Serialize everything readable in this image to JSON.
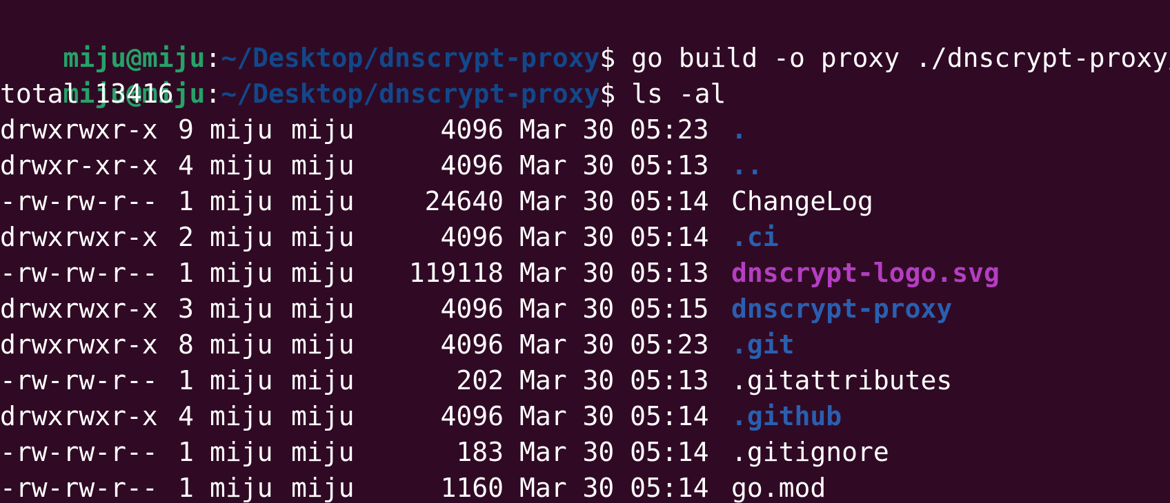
{
  "colors": {
    "background": "#300a24",
    "foreground": "#ffffff",
    "prompt_user": "#26a269",
    "prompt_path": "#12488b",
    "directory": "#2a5fb0",
    "image_file": "#b43ec2"
  },
  "prompts": [
    {
      "user_host": "miju@miju",
      "sep": ":",
      "path": "~/Desktop/dnscrypt-proxy",
      "symbol": "$",
      "command": " go build -o proxy ./dnscrypt-proxy/"
    },
    {
      "user_host": "miju@miju",
      "sep": ":",
      "path": "~/Desktop/dnscrypt-proxy",
      "symbol": "$",
      "command": " ls -al"
    }
  ],
  "total_line": "total 13416",
  "listing": [
    {
      "perm": "drwxrwxr-x",
      "links": "9",
      "owner": "miju",
      "group": "miju",
      "size": "4096",
      "date": "Mar 30 05:23",
      "name": ".",
      "kind": "dir"
    },
    {
      "perm": "drwxr-xr-x",
      "links": "4",
      "owner": "miju",
      "group": "miju",
      "size": "4096",
      "date": "Mar 30 05:13",
      "name": "..",
      "kind": "dir"
    },
    {
      "perm": "-rw-rw-r--",
      "links": "1",
      "owner": "miju",
      "group": "miju",
      "size": "24640",
      "date": "Mar 30 05:14",
      "name": "ChangeLog",
      "kind": "file"
    },
    {
      "perm": "drwxrwxr-x",
      "links": "2",
      "owner": "miju",
      "group": "miju",
      "size": "4096",
      "date": "Mar 30 05:14",
      "name": ".ci",
      "kind": "dir"
    },
    {
      "perm": "-rw-rw-r--",
      "links": "1",
      "owner": "miju",
      "group": "miju",
      "size": "119118",
      "date": "Mar 30 05:13",
      "name": "dnscrypt-logo.svg",
      "kind": "image"
    },
    {
      "perm": "drwxrwxr-x",
      "links": "3",
      "owner": "miju",
      "group": "miju",
      "size": "4096",
      "date": "Mar 30 05:15",
      "name": "dnscrypt-proxy",
      "kind": "dir"
    },
    {
      "perm": "drwxrwxr-x",
      "links": "8",
      "owner": "miju",
      "group": "miju",
      "size": "4096",
      "date": "Mar 30 05:23",
      "name": ".git",
      "kind": "dir"
    },
    {
      "perm": "-rw-rw-r--",
      "links": "1",
      "owner": "miju",
      "group": "miju",
      "size": "202",
      "date": "Mar 30 05:13",
      "name": ".gitattributes",
      "kind": "file"
    },
    {
      "perm": "drwxrwxr-x",
      "links": "4",
      "owner": "miju",
      "group": "miju",
      "size": "4096",
      "date": "Mar 30 05:14",
      "name": ".github",
      "kind": "dir"
    },
    {
      "perm": "-rw-rw-r--",
      "links": "1",
      "owner": "miju",
      "group": "miju",
      "size": "183",
      "date": "Mar 30 05:14",
      "name": ".gitignore",
      "kind": "file"
    },
    {
      "perm": "-rw-rw-r--",
      "links": "1",
      "owner": "miju",
      "group": "miju",
      "size": "1160",
      "date": "Mar 30 05:14",
      "name": "go.mod",
      "kind": "file"
    }
  ]
}
